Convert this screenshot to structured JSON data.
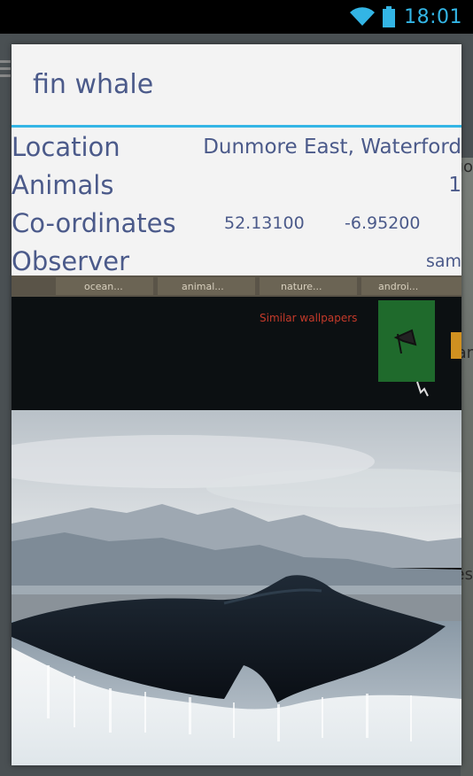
{
  "status_bar": {
    "time": "18:01",
    "wifi_icon": "wifi-icon",
    "battery_icon": "battery-icon",
    "accent_color": "#33b5e5"
  },
  "dialog": {
    "title": "fin whale",
    "accent_color": "#33b5e5",
    "text_color": "#4b5a8a",
    "rows": {
      "location": {
        "label": "Location",
        "value": "Dunmore East, Waterford"
      },
      "animals": {
        "label": "Animals",
        "value": "1"
      },
      "coordinates": {
        "label": "Co-ordinates",
        "latitude": "52.13100",
        "longitude": "-6.95200"
      },
      "observer": {
        "label": "Observer",
        "value": "sam"
      }
    },
    "photo": {
      "tab_labels": [
        "ocean...",
        "animal...",
        "nature...",
        "androi..."
      ],
      "overlay_text": "Similar wallpapers"
    }
  },
  "background": {
    "map_fragments": [
      "go",
      "ar",
      "es"
    ]
  }
}
